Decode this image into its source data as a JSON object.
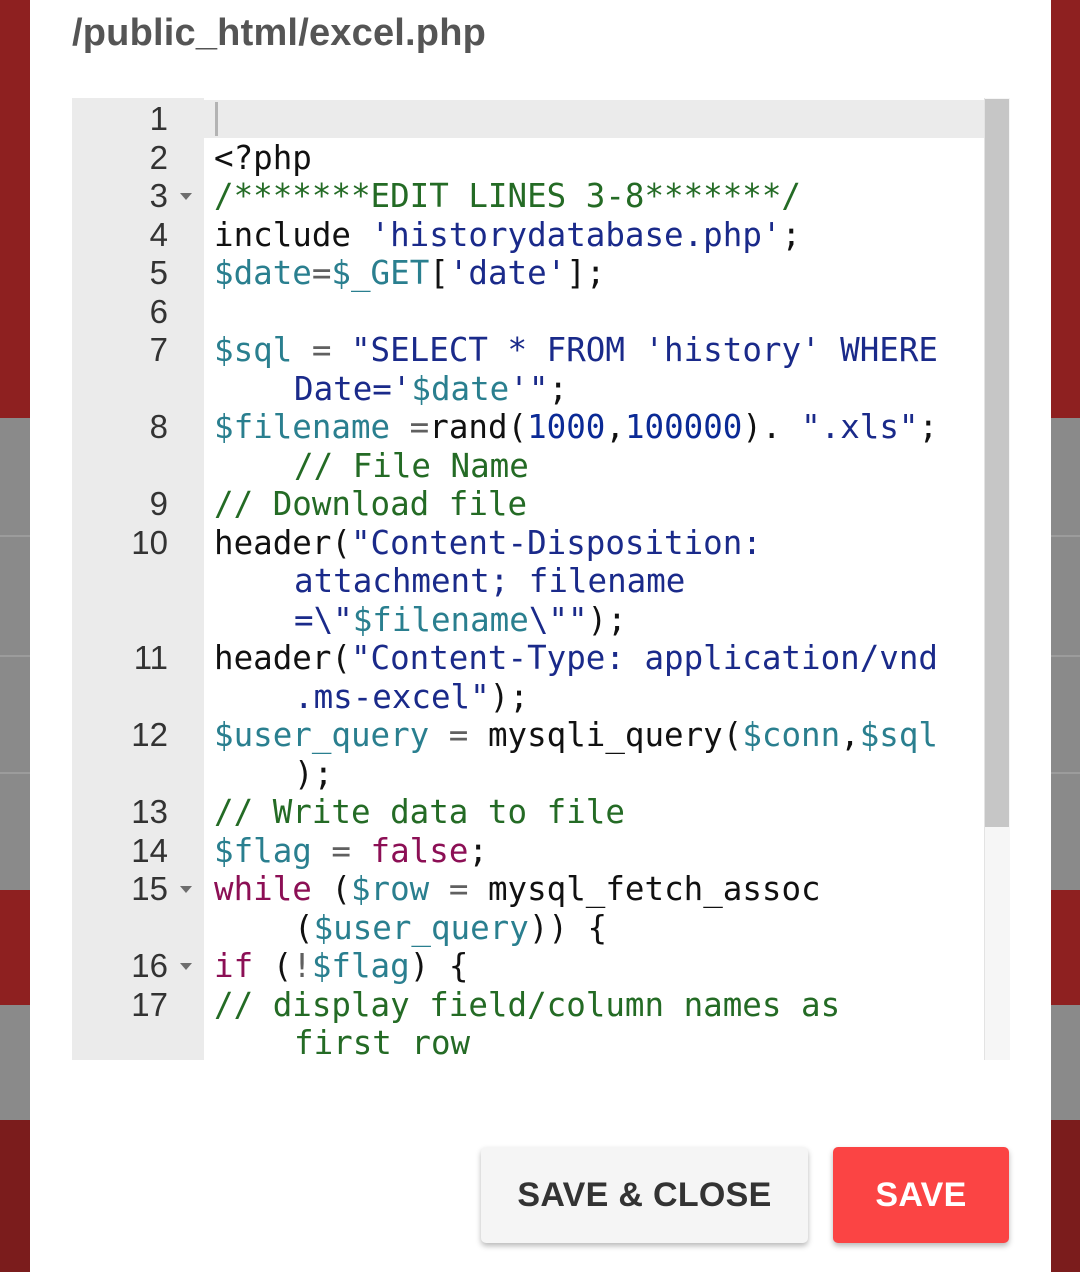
{
  "dialog": {
    "title": "/public_html/excel.php",
    "buttons": {
      "save_close": "SAVE & CLOSE",
      "save": "SAVE"
    }
  },
  "editor": {
    "lines": [
      {
        "num": "1",
        "fold": false,
        "rows": []
      },
      {
        "num": "2",
        "fold": false,
        "rows": [
          [
            [
              "<?php",
              "plain"
            ]
          ]
        ]
      },
      {
        "num": "3",
        "fold": true,
        "rows": [
          [
            [
              "/*******EDIT LINES 3-8*******/",
              "comment"
            ]
          ]
        ]
      },
      {
        "num": "4",
        "fold": false,
        "rows": [
          [
            [
              "include ",
              "plain"
            ],
            [
              "'historydatabase.php'",
              "string"
            ],
            [
              ";",
              "plain"
            ]
          ]
        ]
      },
      {
        "num": "5",
        "fold": false,
        "rows": [
          [
            [
              "$date",
              "var"
            ],
            [
              "=",
              "op"
            ],
            [
              "$_GET",
              "var"
            ],
            [
              "[",
              "plain"
            ],
            [
              "'date'",
              "string"
            ],
            [
              "];",
              "plain"
            ]
          ]
        ]
      },
      {
        "num": "6",
        "fold": false,
        "rows": []
      },
      {
        "num": "7",
        "fold": false,
        "rows": [
          [
            [
              "$sql",
              "var"
            ],
            [
              " = ",
              "op"
            ],
            [
              "\"SELECT * FROM 'history' WHERE",
              "string"
            ]
          ],
          [
            [
              "Date='",
              "string"
            ],
            [
              "$date",
              "var"
            ],
            [
              "'\"",
              "string"
            ],
            [
              ";",
              "plain"
            ]
          ]
        ]
      },
      {
        "num": "8",
        "fold": false,
        "rows": [
          [
            [
              "$filename",
              "var"
            ],
            [
              " =",
              "op"
            ],
            [
              "rand(",
              "plain"
            ],
            [
              "1000",
              "num"
            ],
            [
              ",",
              "plain"
            ],
            [
              "100000",
              "num"
            ],
            [
              "). ",
              "plain"
            ],
            [
              "\".xls\"",
              "string"
            ],
            [
              ";",
              "plain"
            ]
          ],
          [
            [
              "// File Name",
              "comment"
            ]
          ]
        ]
      },
      {
        "num": "9",
        "fold": false,
        "rows": [
          [
            [
              "// Download file",
              "comment"
            ]
          ]
        ]
      },
      {
        "num": "10",
        "fold": false,
        "rows": [
          [
            [
              "header(",
              "plain"
            ],
            [
              "\"Content-Disposition:",
              "string"
            ]
          ],
          [
            [
              "attachment; filename",
              "string"
            ]
          ],
          [
            [
              "=\\\"",
              "string"
            ],
            [
              "$filename",
              "var"
            ],
            [
              "\\\"\"",
              "string"
            ],
            [
              ");",
              "plain"
            ]
          ]
        ]
      },
      {
        "num": "11",
        "fold": false,
        "rows": [
          [
            [
              "header(",
              "plain"
            ],
            [
              "\"Content-Type: application/vnd",
              "string"
            ]
          ],
          [
            [
              ".ms-excel\"",
              "string"
            ],
            [
              ");",
              "plain"
            ]
          ]
        ]
      },
      {
        "num": "12",
        "fold": false,
        "rows": [
          [
            [
              "$user_query",
              "var"
            ],
            [
              " = ",
              "op"
            ],
            [
              "mysqli_query(",
              "plain"
            ],
            [
              "$conn",
              "var"
            ],
            [
              ",",
              "plain"
            ],
            [
              "$sql",
              "var"
            ]
          ],
          [
            [
              ");",
              "plain"
            ]
          ]
        ]
      },
      {
        "num": "13",
        "fold": false,
        "rows": [
          [
            [
              "// Write data to file",
              "comment"
            ]
          ]
        ]
      },
      {
        "num": "14",
        "fold": false,
        "rows": [
          [
            [
              "$flag",
              "var"
            ],
            [
              " = ",
              "op"
            ],
            [
              "false",
              "kw"
            ],
            [
              ";",
              "plain"
            ]
          ]
        ]
      },
      {
        "num": "15",
        "fold": true,
        "rows": [
          [
            [
              "while",
              "kw"
            ],
            [
              " (",
              "plain"
            ],
            [
              "$row",
              "var"
            ],
            [
              " = ",
              "op"
            ],
            [
              "mysql_fetch_assoc",
              "plain"
            ]
          ],
          [
            [
              "(",
              "plain"
            ],
            [
              "$user_query",
              "var"
            ],
            [
              ")) {",
              "plain"
            ]
          ]
        ]
      },
      {
        "num": "16",
        "fold": true,
        "rows": [
          [
            [
              "if",
              "kw"
            ],
            [
              " (",
              "plain"
            ],
            [
              "!",
              "op"
            ],
            [
              "$flag",
              "var"
            ],
            [
              ") {",
              "plain"
            ]
          ]
        ]
      },
      {
        "num": "17",
        "fold": false,
        "rows": [
          [
            [
              "// display field/column names as",
              "comment"
            ]
          ],
          [
            [
              "first row",
              "comment"
            ]
          ]
        ]
      }
    ]
  }
}
